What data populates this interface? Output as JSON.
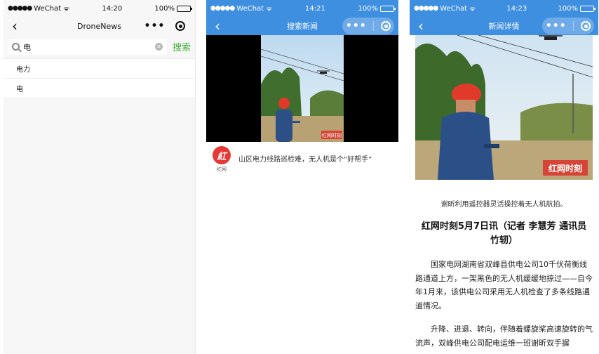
{
  "colors": {
    "accent": "#3f8fe0",
    "search_green": "#3cb035",
    "logo_red": "#e53935"
  },
  "screen1": {
    "status": {
      "carrier": "WeChat",
      "time": "14:20",
      "battery": "100%"
    },
    "nav": {
      "title": "DroneNews"
    },
    "search": {
      "value": "电",
      "button_label": "搜索"
    },
    "suggestions": [
      "电力",
      "电"
    ]
  },
  "screen2": {
    "status": {
      "carrier": "WeChat",
      "time": "14:21",
      "battery": "100%"
    },
    "nav": {
      "title": "搜索新闻"
    },
    "video": {
      "watermark": "红网时刻"
    },
    "result": {
      "source_name": "红网",
      "title": "山区电力线路巡检难，无人机是个“好帮手”"
    }
  },
  "screen3": {
    "status": {
      "carrier": "WeChat",
      "time": "14:23",
      "battery": "100%"
    },
    "nav": {
      "title": "新闻详情"
    },
    "photo": {
      "watermark": "红网时刻"
    },
    "article": {
      "caption": "谢昕利用遥控器灵活操控着无人机航拍。",
      "headline": "红网时刻5月7日讯（记者 李慧芳 通讯员 竹轫）",
      "paragraphs": [
        "国家电网湖南省双峰县供电公司10千伏荷衡线路通道上方，一架黑色的无人机缓缓地掠过——自今年1月来，该供电公司采用无人机检查了多条线路通道情况。",
        "升降、进退、转向，伴随着螺旋桨高速旋转的气流声，双峰供电公司配电运维一班谢昕双手握"
      ]
    }
  }
}
